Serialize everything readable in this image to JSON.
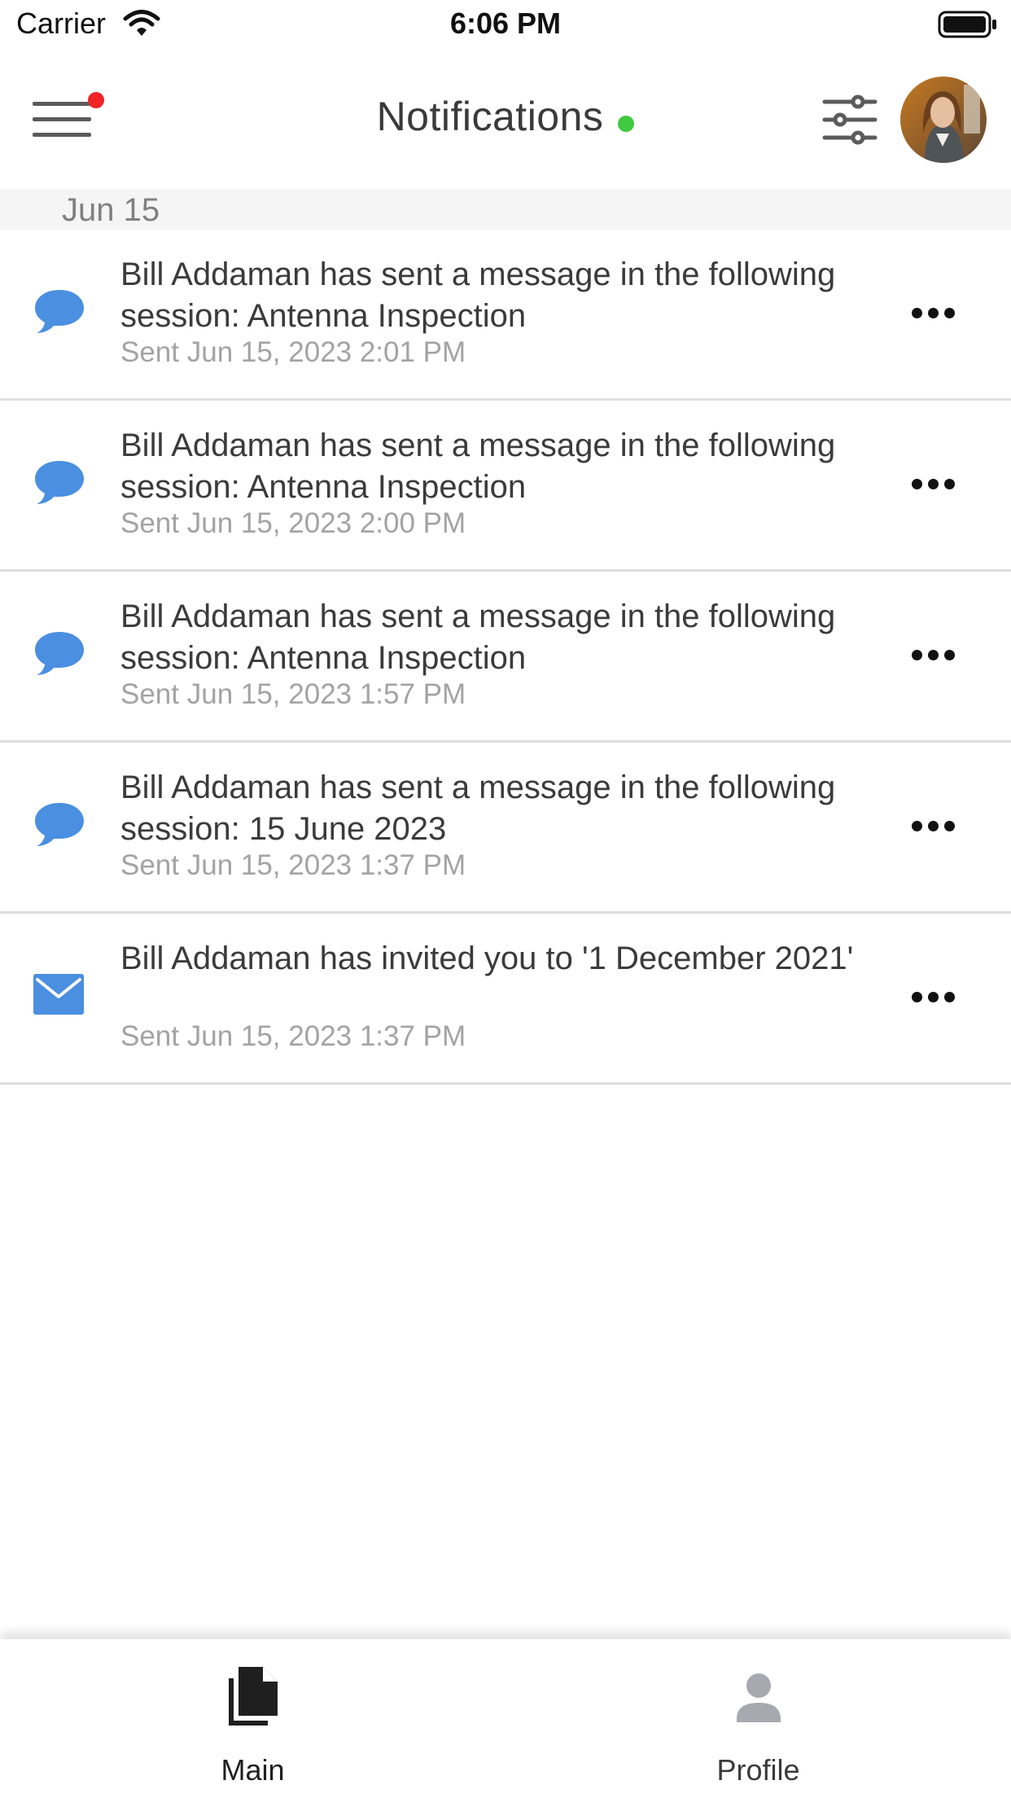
{
  "status_bar": {
    "carrier": "Carrier",
    "time": "6:06 PM"
  },
  "header": {
    "title": "Notifications"
  },
  "section": {
    "date": "Jun 15"
  },
  "notifications": [
    {
      "type": "message",
      "icon": "chat-bubble-icon",
      "text": "Bill Addaman has sent a message in the following session: Antenna Inspection",
      "sent": "Sent Jun 15, 2023 2:01 PM"
    },
    {
      "type": "message",
      "icon": "chat-bubble-icon",
      "text": "Bill Addaman has sent a message in the following session: Antenna Inspection",
      "sent": "Sent Jun 15, 2023 2:00 PM"
    },
    {
      "type": "message",
      "icon": "chat-bubble-icon",
      "text": "Bill Addaman has sent a message in the following session: Antenna Inspection",
      "sent": "Sent Jun 15, 2023 1:57 PM"
    },
    {
      "type": "message",
      "icon": "chat-bubble-icon",
      "text": "Bill Addaman has sent a message in the following session: 15 June 2023",
      "sent": "Sent Jun 15, 2023 1:37 PM"
    },
    {
      "type": "invite",
      "icon": "envelope-icon",
      "text": "Bill Addaman has invited you to '1 December 2021'",
      "sent": "Sent Jun 15, 2023 1:37 PM"
    }
  ],
  "tabs": [
    {
      "label": "Main",
      "icon": "document-icon",
      "active": true
    },
    {
      "label": "Profile",
      "icon": "person-icon",
      "active": false
    }
  ],
  "colors": {
    "accent": "#4a8fe0",
    "unread_dot": "#f02424",
    "online_dot": "#3fca3f",
    "tab_active": "#1f1f1f",
    "tab_inactive": "#3b3b3b"
  }
}
